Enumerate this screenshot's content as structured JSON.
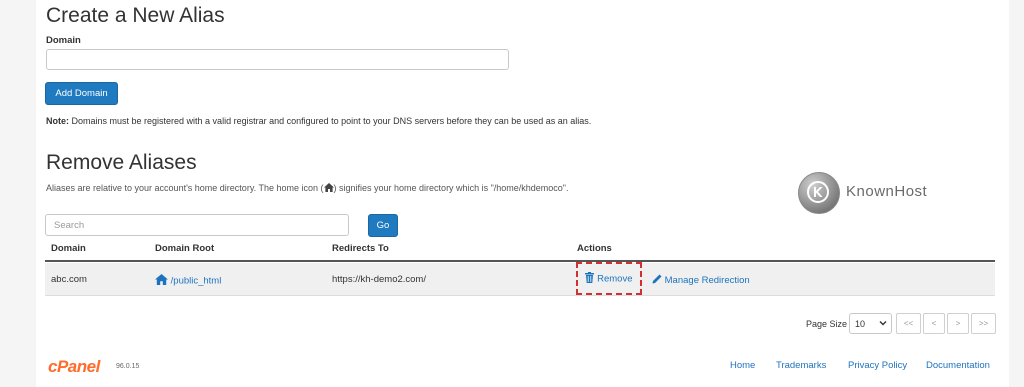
{
  "create": {
    "title": "Create a New Alias",
    "domain_label": "Domain",
    "domain_value": "",
    "add_button": "Add Domain",
    "note_bold": "Note:",
    "note_text": " Domains must be registered with a valid registrar and configured to point to your DNS servers before they can be used as an alias."
  },
  "remove": {
    "title": "Remove Aliases",
    "desc_before": "Aliases are relative to your account's home directory. The home icon (",
    "desc_after": ") signifies your home directory which is \"/home/khdemoco\".",
    "search_placeholder": "Search",
    "go_button": "Go"
  },
  "logo_text": "KnownHost",
  "table": {
    "headers": [
      "Domain",
      "Domain Root",
      "Redirects To",
      "Actions"
    ],
    "rows": [
      {
        "domain": "abc.com",
        "root": "/public_html",
        "redirect": "https://kh-demo2.com/",
        "remove": "Remove",
        "manage": "Manage Redirection"
      }
    ]
  },
  "pagination": {
    "page_size_label": "Page Size",
    "page_size_value": "10",
    "first": "<<",
    "prev": "<",
    "next": ">",
    "last": ">>"
  },
  "footer": {
    "brand": "cPanel",
    "version": "96.0.15",
    "links": [
      "Home",
      "Trademarks",
      "Privacy Policy",
      "Documentation"
    ]
  },
  "colors": {
    "primary_button": "#1f7ac0",
    "link": "#1e73be",
    "highlight_box": "#d03030",
    "cpanel_brand": "#ff6c2c"
  }
}
